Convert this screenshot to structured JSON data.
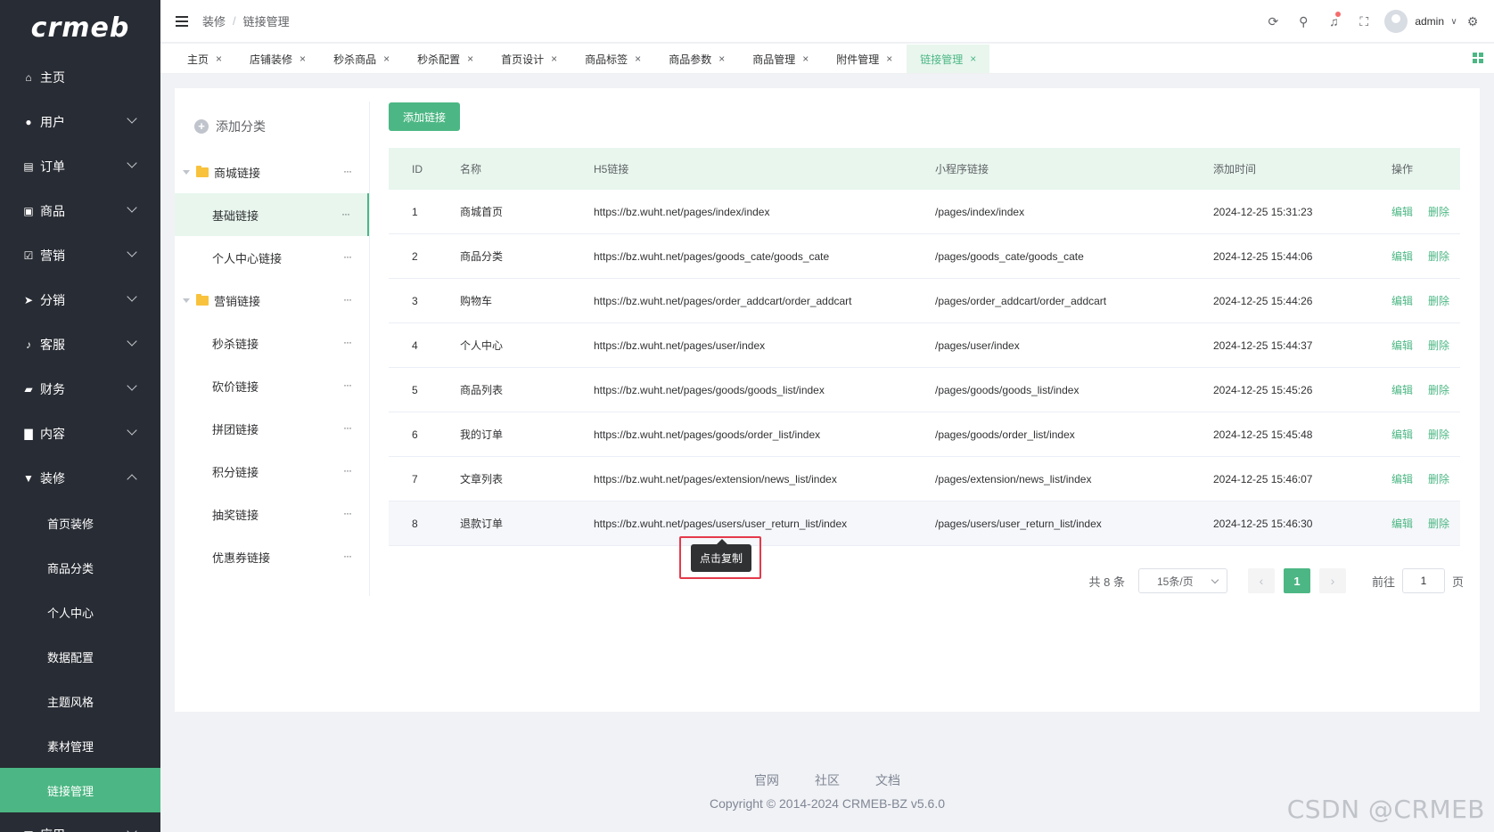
{
  "logo": "crmeb",
  "sidebar": {
    "items": [
      {
        "label": "主页",
        "icon": "home-icon",
        "glyph": "⌂",
        "has_children": false
      },
      {
        "label": "用户",
        "icon": "user-icon",
        "glyph": "●",
        "has_children": true
      },
      {
        "label": "订单",
        "icon": "order-icon",
        "glyph": "▤",
        "has_children": true
      },
      {
        "label": "商品",
        "icon": "product-icon",
        "glyph": "▣",
        "has_children": true
      },
      {
        "label": "营销",
        "icon": "marketing-icon",
        "glyph": "☑",
        "has_children": true
      },
      {
        "label": "分销",
        "icon": "distribution-icon",
        "glyph": "➤",
        "has_children": true
      },
      {
        "label": "客服",
        "icon": "bell-icon",
        "glyph": "♪",
        "has_children": true
      },
      {
        "label": "财务",
        "icon": "finance-icon",
        "glyph": "▰",
        "has_children": true
      },
      {
        "label": "内容",
        "icon": "content-icon",
        "glyph": "▇",
        "has_children": true
      },
      {
        "label": "装修",
        "icon": "decorate-icon",
        "glyph": "▼",
        "has_children": true,
        "expanded": true
      }
    ],
    "sub_items": [
      "首页装修",
      "商品分类",
      "个人中心",
      "数据配置",
      "主题风格",
      "素材管理",
      "链接管理"
    ],
    "active_sub": "链接管理",
    "bottom_item": {
      "label": "应用",
      "icon": "app-icon",
      "glyph": "▦"
    }
  },
  "header": {
    "breadcrumb": [
      "装修",
      "链接管理"
    ],
    "breadcrumb_sep": "/",
    "user_name": "admin",
    "icons": [
      "refresh-icon",
      "search-icon",
      "notification-icon",
      "fullscreen-icon",
      "settings-icon"
    ]
  },
  "tabs": [
    {
      "label": "主页"
    },
    {
      "label": "店铺装修"
    },
    {
      "label": "秒杀商品"
    },
    {
      "label": "秒杀配置"
    },
    {
      "label": "首页设计"
    },
    {
      "label": "商品标签"
    },
    {
      "label": "商品参数"
    },
    {
      "label": "商品管理"
    },
    {
      "label": "附件管理"
    },
    {
      "label": "链接管理",
      "active": true
    }
  ],
  "tab_close_glyph": "×",
  "left_panel": {
    "add_category": "添加分类",
    "groups": [
      {
        "label": "商城链接",
        "children": [
          "基础链接",
          "个人中心链接"
        ]
      },
      {
        "label": "营销链接",
        "children": [
          "秒杀链接",
          "砍价链接",
          "拼团链接",
          "积分链接",
          "抽奖链接",
          "优惠券链接"
        ]
      }
    ],
    "selected": "基础链接",
    "more_glyph": "···"
  },
  "main": {
    "add_button": "添加链接",
    "columns": [
      "ID",
      "名称",
      "H5链接",
      "小程序链接",
      "添加时间",
      "操作"
    ],
    "rows": [
      {
        "id": "1",
        "name": "商城首页",
        "h5": "https://bz.wuht.net/pages/index/index",
        "mp": "/pages/index/index",
        "time": "2024-12-25 15:31:23"
      },
      {
        "id": "2",
        "name": "商品分类",
        "h5": "https://bz.wuht.net/pages/goods_cate/goods_cate",
        "mp": "/pages/goods_cate/goods_cate",
        "time": "2024-12-25 15:44:06"
      },
      {
        "id": "3",
        "name": "购物车",
        "h5": "https://bz.wuht.net/pages/order_addcart/order_addcart",
        "mp": "/pages/order_addcart/order_addcart",
        "time": "2024-12-25 15:44:26"
      },
      {
        "id": "4",
        "name": "个人中心",
        "h5": "https://bz.wuht.net/pages/user/index",
        "mp": "/pages/user/index",
        "time": "2024-12-25 15:44:37"
      },
      {
        "id": "5",
        "name": "商品列表",
        "h5": "https://bz.wuht.net/pages/goods/goods_list/index",
        "mp": "/pages/goods/goods_list/index",
        "time": "2024-12-25 15:45:26"
      },
      {
        "id": "6",
        "name": "我的订单",
        "h5": "https://bz.wuht.net/pages/goods/order_list/index",
        "mp": "/pages/goods/order_list/index",
        "time": "2024-12-25 15:45:48"
      },
      {
        "id": "7",
        "name": "文章列表",
        "h5": "https://bz.wuht.net/pages/extension/news_list/index",
        "mp": "/pages/extension/news_list/index",
        "time": "2024-12-25 15:46:07"
      },
      {
        "id": "8",
        "name": "退款订单",
        "h5": "https://bz.wuht.net/pages/users/user_return_list/index",
        "mp": "/pages/users/user_return_list/index",
        "time": "2024-12-25 15:46:30"
      }
    ],
    "edit_label": "编辑",
    "delete_label": "删除",
    "tooltip": "点击复制"
  },
  "pagination": {
    "total": "共 8 条",
    "page_size": "15条/页",
    "current": "1",
    "goto_label": "前往",
    "goto_value": "1",
    "page_suffix": "页",
    "prev_glyph": "‹",
    "next_glyph": "›"
  },
  "footer": {
    "links": [
      "官网",
      "社区",
      "文档"
    ],
    "copyright": "Copyright © 2014-2024 CRMEB-BZ v5.6.0"
  },
  "watermark": "CSDN @CRMEB",
  "colors": {
    "accent": "#4cb784",
    "sidebar_bg": "#282c34",
    "highlight_border": "#e5394b"
  }
}
